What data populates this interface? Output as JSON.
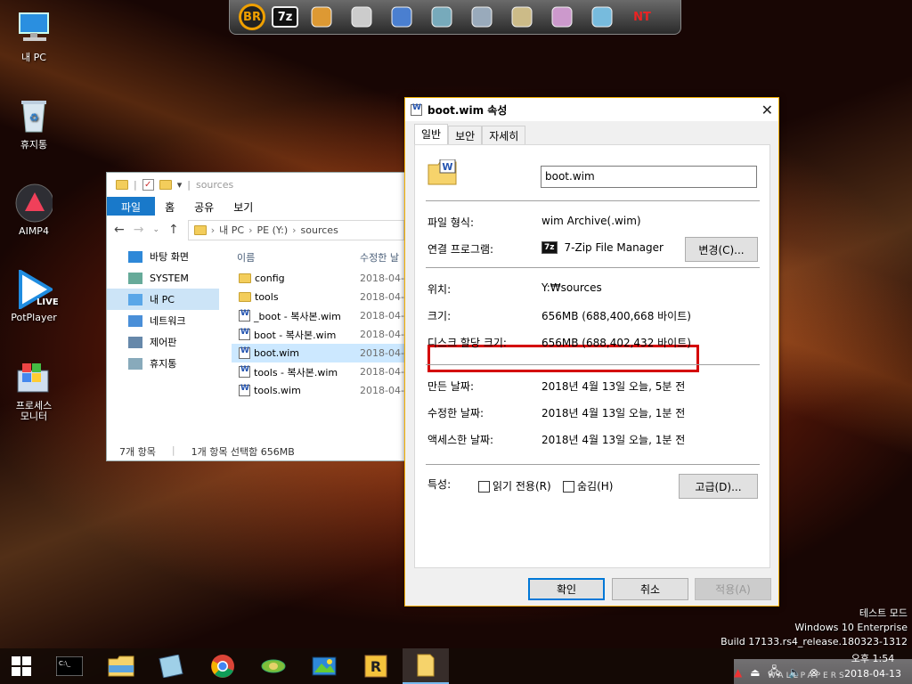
{
  "dock": {
    "items": [
      {
        "icon": "br-icon",
        "label": "BR",
        "color": "#f0a000"
      },
      {
        "icon": "7zip-icon",
        "label": "7z",
        "color": "#ffffff"
      },
      {
        "icon": "disk-chart-icon",
        "label": "",
        "color": "#d93"
      },
      {
        "icon": "floppy-icon",
        "label": "",
        "color": "#ccc"
      },
      {
        "icon": "partition-icon",
        "label": "",
        "color": "#4a7fd0"
      },
      {
        "icon": "network-pc-icon",
        "label": "",
        "color": "#7ab"
      },
      {
        "icon": "settings-pc-icon",
        "label": "",
        "color": "#9ab"
      },
      {
        "icon": "archive-box-icon",
        "label": "",
        "color": "#cb8"
      },
      {
        "icon": "disc-icon",
        "label": "",
        "color": "#c9c"
      },
      {
        "icon": "book-icon",
        "label": "",
        "color": "#7bd"
      },
      {
        "icon": "nt-icon",
        "label": "NT",
        "color": "#e22"
      }
    ]
  },
  "desktop": {
    "icons": [
      {
        "name": "desktop-icon-this-pc",
        "label": "내 PC"
      },
      {
        "name": "desktop-icon-recycle-bin",
        "label": "휴지통"
      },
      {
        "name": "desktop-icon-aimp4",
        "label": "AIMP4"
      },
      {
        "name": "desktop-icon-potplayer",
        "label": "PotPlayer"
      },
      {
        "name": "desktop-icon-process-monitor",
        "label": "프로세스\n모니터"
      }
    ],
    "potplayer_badge": "LIVE"
  },
  "explorer": {
    "title": "sources",
    "ribbon": [
      "파일",
      "홈",
      "공유",
      "보기"
    ],
    "address": [
      "내 PC",
      "PE (Y:)",
      "sources"
    ],
    "nav": [
      {
        "label": "바탕 화면",
        "selected": false
      },
      {
        "label": "SYSTEM",
        "selected": false
      },
      {
        "label": "내 PC",
        "selected": true
      },
      {
        "label": "네트워크",
        "selected": false
      },
      {
        "label": "제어판",
        "selected": false
      },
      {
        "label": "휴지통",
        "selected": false
      }
    ],
    "columns": {
      "name": "이름",
      "date": "수정한 날"
    },
    "files": [
      {
        "name": "config",
        "type": "folder",
        "date": "2018-04-",
        "selected": false
      },
      {
        "name": "tools",
        "type": "folder",
        "date": "2018-04-",
        "selected": false
      },
      {
        "name": "_boot - 복사본.wim",
        "type": "wim",
        "date": "2018-04-",
        "selected": false
      },
      {
        "name": "boot - 복사본.wim",
        "type": "wim",
        "date": "2018-04-",
        "selected": false
      },
      {
        "name": "boot.wim",
        "type": "wim",
        "date": "2018-04-",
        "selected": true
      },
      {
        "name": "tools - 복사본.wim",
        "type": "wim",
        "date": "2018-04-",
        "selected": false
      },
      {
        "name": "tools.wim",
        "type": "wim",
        "date": "2018-04-",
        "selected": false
      }
    ],
    "status_count": "7개 항목",
    "status_selection": "1개 항목 선택함 656MB"
  },
  "dialog": {
    "title": "boot.wim 속성",
    "tabs": [
      "일반",
      "보안",
      "자세히"
    ],
    "filename": "boot.wim",
    "rows": {
      "type_label": "파일 형식:",
      "type_value": "wim Archive(.wim)",
      "opens_label": "연결 프로그램:",
      "opens_value": "7-Zip File Manager",
      "opens_icon_text": "7z",
      "change_button": "변경(C)...",
      "location_label": "위치:",
      "location_value": "Y:₩sources",
      "size_label": "크기:",
      "size_value": "656MB (688,400,668 바이트)",
      "disk_label": "디스크 할당 크기:",
      "disk_value": "656MB (688,402,432 바이트)",
      "created_label": "만든 날짜:",
      "created_value": "2018년 4월 13일 오늘, 5분 전",
      "modified_label": "수정한 날짜:",
      "modified_value": "2018년 4월 13일 오늘, 1분 전",
      "accessed_label": "액세스한 날짜:",
      "accessed_value": "2018년 4월 13일 오늘, 1분 전",
      "attr_label": "특성:",
      "readonly_label": "읽기 전용(R)",
      "hidden_label": "숨김(H)",
      "advanced_button": "고급(D)..."
    },
    "ok_button": "확인",
    "cancel_button": "취소",
    "apply_button": "적용(A)",
    "highlight_color": "#d40000"
  },
  "watermark": {
    "line1": "테스트 모드",
    "line2": "Windows 10 Enterprise",
    "line3": "Build 17133.rs4_release.180323-1312"
  },
  "taskbar": {
    "clock_time": "오후 1:54",
    "clock_date": "2018-04-13",
    "wallpaper_text": "WALLPAPERS"
  }
}
